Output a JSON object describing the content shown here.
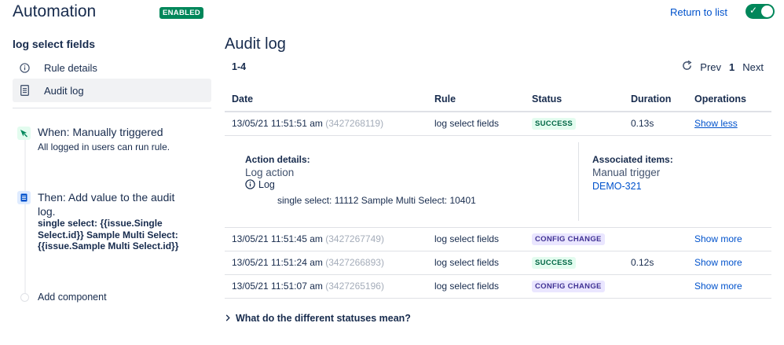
{
  "header": {
    "title": "Automation",
    "status": "ENABLED",
    "return_label": "Return to list",
    "toggle_on": true,
    "accent": "#00875a"
  },
  "sidebar": {
    "rule_name": "log select fields",
    "nav": [
      {
        "label": "Rule details",
        "icon": "info-icon"
      },
      {
        "label": "Audit log",
        "icon": "document-icon",
        "active": true
      }
    ],
    "steps": {
      "trigger_title": "When: Manually triggered",
      "trigger_sub": "All logged in users can run rule.",
      "action_title": "Then: Add value to the audit log.",
      "action_code": "single select: {{issue.Single Select.id}} Sample Multi Select: {{issue.Sample Multi Select.id}}",
      "add_component": "Add component"
    }
  },
  "main": {
    "title": "Audit log",
    "range": "1-4",
    "pager": {
      "prev": "Prev",
      "current": "1",
      "next": "Next"
    },
    "columns": [
      "Date",
      "Rule",
      "Status",
      "Duration",
      "Operations"
    ],
    "rows": [
      {
        "date": "13/05/21 11:51:51 am",
        "id": "(3427268119)",
        "rule": "log select fields",
        "status": "SUCCESS",
        "status_type": "success",
        "duration": "0.13s",
        "op": "Show less"
      },
      {
        "date": "13/05/21 11:51:45 am",
        "id": "(3427267749)",
        "rule": "log select fields",
        "status": "CONFIG CHANGE",
        "status_type": "config",
        "duration": "",
        "op": "Show more"
      },
      {
        "date": "13/05/21 11:51:24 am",
        "id": "(3427266893)",
        "rule": "log select fields",
        "status": "SUCCESS",
        "status_type": "success",
        "duration": "0.12s",
        "op": "Show more"
      },
      {
        "date": "13/05/21 11:51:07 am",
        "id": "(3427265196)",
        "rule": "log select fields",
        "status": "CONFIG CHANGE",
        "status_type": "config",
        "duration": "",
        "op": "Show more"
      }
    ],
    "detail": {
      "action_header": "Action details:",
      "action_name": "Log action",
      "log_label": "Log",
      "log_message": "single select: 11112 Sample Multi Select: 10401",
      "assoc_header": "Associated items:",
      "assoc_trigger": "Manual trigger",
      "assoc_issue": "DEMO-321"
    },
    "faq": "What do the different statuses mean?"
  }
}
